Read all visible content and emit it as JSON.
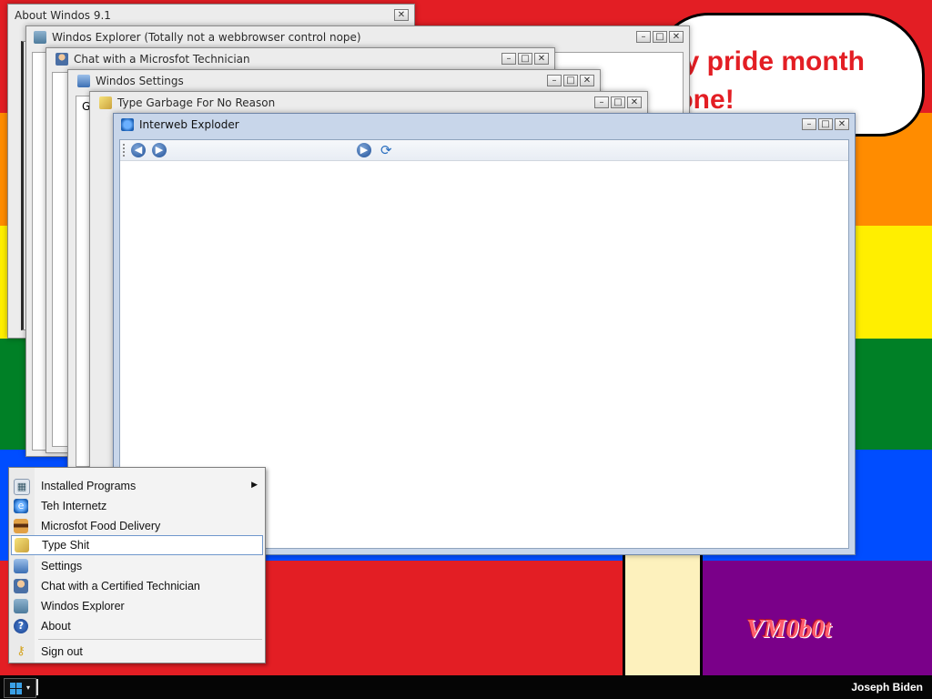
{
  "desktop": {
    "rainbow_colors": [
      "#e31e24",
      "#ff8c00",
      "#ffef00",
      "#008026",
      "#004dff",
      "#750787"
    ],
    "speech_bubble_text": "ppy pride month\nryone!",
    "watermark": "VM0b0t"
  },
  "windows": {
    "about": {
      "title": "About Windos 9.1"
    },
    "explorer": {
      "title": "Windos Explorer (Totally not a webbrowser control nope)"
    },
    "chat": {
      "title": "Chat with a Microsfot Technician"
    },
    "settings": {
      "title": "Windos Settings",
      "field_fragment": "G"
    },
    "type_garbage": {
      "title": "Type Garbage For No Reason"
    },
    "interweb": {
      "title": "Interweb Exploder"
    }
  },
  "window_controls": {
    "minimize": "–",
    "maximize": "□",
    "close": "✕"
  },
  "browser_toolbar": {
    "back": "◀",
    "forward": "▶",
    "go": "▶",
    "refresh": "⟳"
  },
  "start_menu": {
    "items": [
      {
        "label": "Installed Programs",
        "icon": "programs-icon",
        "submenu": true
      },
      {
        "label": "Teh Internetz",
        "icon": "internet-explorer-icon"
      },
      {
        "label": "Microsfot Food Delivery",
        "icon": "burger-icon"
      },
      {
        "label": "Type Shit",
        "icon": "notepad-icon",
        "highlighted": true
      },
      {
        "label": "Settings",
        "icon": "settings-icon"
      },
      {
        "label": "Chat with a Certified Technician",
        "icon": "technician-icon"
      },
      {
        "label": "Windos Explorer",
        "icon": "explorer-icon"
      },
      {
        "label": "About",
        "icon": "help-icon"
      },
      {
        "label": "Sign out",
        "icon": "key-icon"
      }
    ],
    "submenu_arrow": "▶"
  },
  "taskbar": {
    "user": "Joseph Biden",
    "start_caret": "▾"
  }
}
